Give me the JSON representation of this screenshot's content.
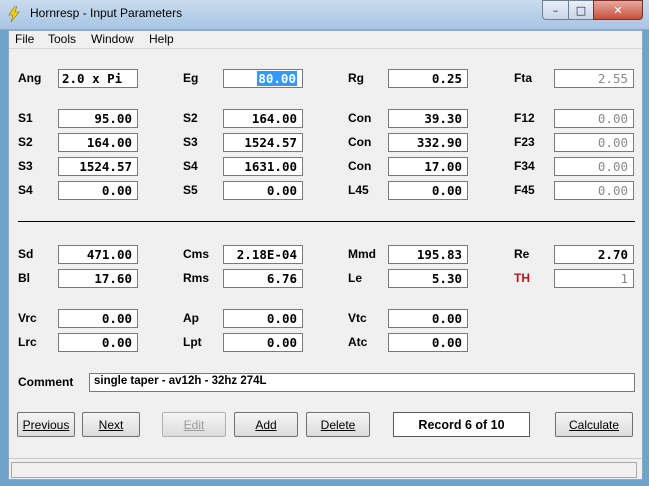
{
  "window": {
    "title": "Hornresp - Input Parameters",
    "min_label": "–",
    "max_label": "□",
    "close_label": "✕"
  },
  "menu": [
    "File",
    "Tools",
    "Window",
    "Help"
  ],
  "params": {
    "ang": {
      "label": "Ang",
      "value": "2.0 x Pi"
    },
    "eg": {
      "label": "Eg",
      "value": "80.00"
    },
    "rg": {
      "label": "Rg",
      "value": "0.25"
    },
    "fta": {
      "label": "Fta",
      "value": "2.55"
    },
    "s1": {
      "label": "S1",
      "value": "95.00"
    },
    "s2a": {
      "label": "S2",
      "value": "164.00"
    },
    "con1": {
      "label": "Con",
      "value": "39.30"
    },
    "f12": {
      "label": "F12",
      "value": "0.00"
    },
    "s2b": {
      "label": "S2",
      "value": "164.00"
    },
    "s3a": {
      "label": "S3",
      "value": "1524.57"
    },
    "con2": {
      "label": "Con",
      "value": "332.90"
    },
    "f23": {
      "label": "F23",
      "value": "0.00"
    },
    "s3b": {
      "label": "S3",
      "value": "1524.57"
    },
    "s4a": {
      "label": "S4",
      "value": "1631.00"
    },
    "con3": {
      "label": "Con",
      "value": "17.00"
    },
    "f34": {
      "label": "F34",
      "value": "0.00"
    },
    "s4b": {
      "label": "S4",
      "value": "0.00"
    },
    "s5": {
      "label": "S5",
      "value": "0.00"
    },
    "l45": {
      "label": "L45",
      "value": "0.00"
    },
    "f45": {
      "label": "F45",
      "value": "0.00"
    },
    "sd": {
      "label": "Sd",
      "value": "471.00"
    },
    "cms": {
      "label": "Cms",
      "value": "2.18E-04"
    },
    "mmd": {
      "label": "Mmd",
      "value": "195.83"
    },
    "re": {
      "label": "Re",
      "value": "2.70"
    },
    "bl": {
      "label": "Bl",
      "value": "17.60"
    },
    "rms": {
      "label": "Rms",
      "value": "6.76"
    },
    "le": {
      "label": "Le",
      "value": "5.30"
    },
    "th": {
      "label": "TH",
      "value": "1"
    },
    "vrc": {
      "label": "Vrc",
      "value": "0.00"
    },
    "ap": {
      "label": "Ap",
      "value": "0.00"
    },
    "vtc": {
      "label": "Vtc",
      "value": "0.00"
    },
    "lrc": {
      "label": "Lrc",
      "value": "0.00"
    },
    "lpt": {
      "label": "Lpt",
      "value": "0.00"
    },
    "atc": {
      "label": "Atc",
      "value": "0.00"
    }
  },
  "comment": {
    "label": "Comment",
    "value": "single taper - av12h - 32hz 274L"
  },
  "buttons": {
    "previous": "Previous",
    "next": "Next",
    "edit": "Edit",
    "add": "Add",
    "delete": "Delete",
    "calculate": "Calculate"
  },
  "record": "Record 6 of 10",
  "colors": {
    "selection": "#3399ff",
    "th_label": "#b4161b",
    "close_button": "#c5523f"
  }
}
